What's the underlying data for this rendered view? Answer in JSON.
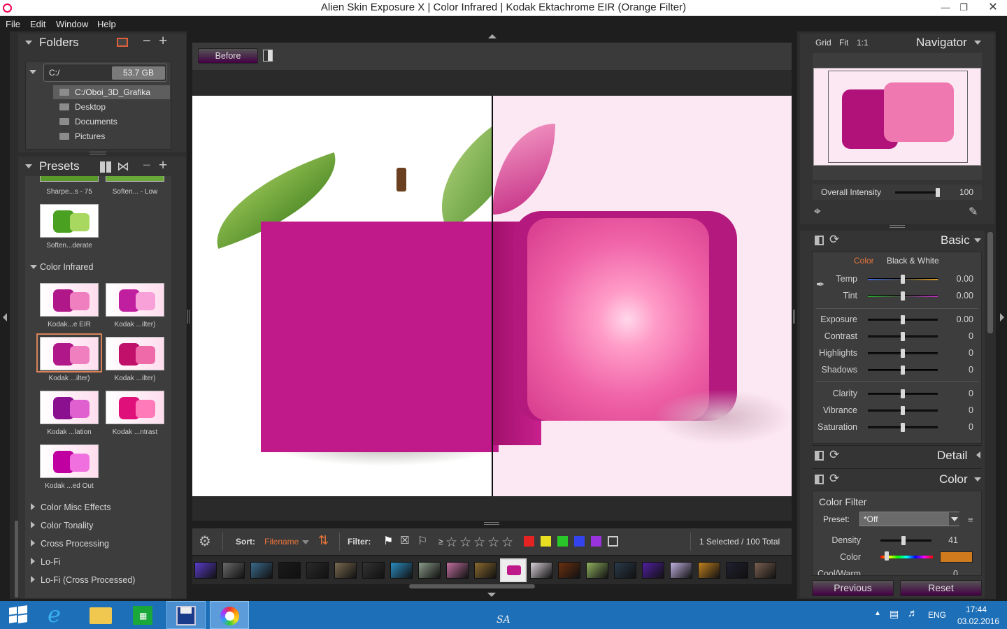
{
  "window": {
    "title": "Alien Skin Exposure X | Color Infrared | Kodak Ektachrome EIR (Orange Filter)"
  },
  "menu": [
    "File",
    "Edit",
    "Window",
    "Help"
  ],
  "folders": {
    "title": "Folders",
    "drive": "C:/",
    "free_space": "53.7 GB",
    "items": [
      "C:/Oboi_3D_Grafika",
      "Desktop",
      "Documents",
      "Pictures"
    ]
  },
  "presets": {
    "title": "Presets",
    "top_labels": [
      "Sharpe...s - 75",
      "Soften... - Low"
    ],
    "single_label": "Soften...derate",
    "group": "Color Infrared",
    "thumbs": [
      "Kodak...e EIR",
      "Kodak ...ilter)",
      "Kodak ...ilter)",
      "Kodak ...ilter)",
      "Kodak ...lation",
      "Kodak ...ntrast",
      "Kodak ...ed Out"
    ],
    "categories": [
      "Color Misc Effects",
      "Color Tonality",
      "Cross Processing",
      "Lo-Fi",
      "Lo-Fi (Cross Processed)"
    ]
  },
  "viewer": {
    "before_label": "Before"
  },
  "filmstrip": {
    "sort_label": "Sort:",
    "sort_value": "Filename",
    "filter_label": "Filter:",
    "rating_prefix": "≥",
    "status": "1 Selected / 100 Total",
    "color_filters": [
      "#e52222",
      "#e8e020",
      "#29c829",
      "#3344ee",
      "#9933dd"
    ],
    "thumb_colors": [
      "#5a3cc8",
      "#6a6a6a",
      "#3a6a8a",
      "#1a1a1a",
      "#2a2a2a",
      "#7a6a50",
      "#333333",
      "#2b8cc0",
      "#8a9a8a",
      "#c070a0",
      "#8a6a30",
      "#d8d0d8",
      "#6a3010",
      "#90b060",
      "#2a3a4a",
      "#5020a0",
      "#c0b0e0",
      "#c08020",
      "#202030",
      "#7a6050",
      "#4a3020",
      "#a0208a"
    ]
  },
  "navigator": {
    "tabs": [
      "Grid",
      "Fit",
      "1:1"
    ],
    "title": "Navigator",
    "intensity_label": "Overall Intensity",
    "intensity_value": "100",
    "intensity_fraction": 1.0
  },
  "basic": {
    "title": "Basic",
    "mode_color": "Color",
    "mode_bw": "Black & White",
    "sliders": [
      {
        "label": "Temp",
        "value": "0.00",
        "pos": 0.5
      },
      {
        "label": "Tint",
        "value": "0.00",
        "pos": 0.5
      },
      {
        "label": "Exposure",
        "value": "0.00",
        "pos": 0.5
      },
      {
        "label": "Contrast",
        "value": "0",
        "pos": 0.5
      },
      {
        "label": "Highlights",
        "value": "0",
        "pos": 0.5
      },
      {
        "label": "Shadows",
        "value": "0",
        "pos": 0.5
      },
      {
        "label": "Clarity",
        "value": "0",
        "pos": 0.5
      },
      {
        "label": "Vibrance",
        "value": "0",
        "pos": 0.5
      },
      {
        "label": "Saturation",
        "value": "0",
        "pos": 0.5
      }
    ]
  },
  "detail": {
    "title": "Detail"
  },
  "color": {
    "title": "Color",
    "filter_title": "Color Filter",
    "preset_label": "Preset:",
    "preset_value": "*Off",
    "density_label": "Density",
    "density_value": "41",
    "density_fraction": 0.41,
    "color_label": "Color",
    "color_swatch": "#d07a1e",
    "coolwarm_label": "Cool/Warm",
    "coolwarm_value": "0"
  },
  "buttons": {
    "previous": "Previous",
    "reset": "Reset"
  },
  "taskbar": {
    "lang": "ENG",
    "time": "17:44",
    "date": "03.02.2016",
    "center_text": "SA"
  }
}
